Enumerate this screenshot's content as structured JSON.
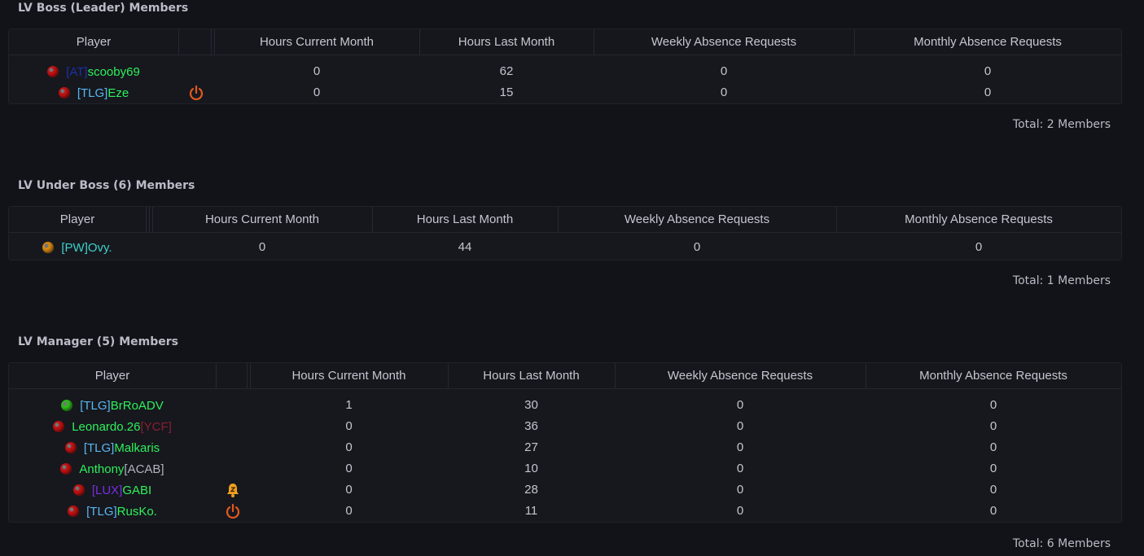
{
  "columns": {
    "player": "Player",
    "hours_current": "Hours Current Month",
    "hours_last": "Hours Last Month",
    "weekly_absence": "Weekly Absence Requests",
    "monthly_absence": "Monthly Absence Requests"
  },
  "status_colors": {
    "red": "#c41212",
    "green": "#2fbf1c",
    "orange": "#d88a12"
  },
  "sections": [
    {
      "title": "LV Boss (Leader) Members",
      "total": "Total: 2 Members",
      "rows": [
        {
          "status": "red",
          "tag": "[AT]",
          "tag_color": "#1f2fa8",
          "name": "scooby69",
          "name_color": "#2ef05a",
          "suffix": "",
          "suffix_color": "",
          "icon": "",
          "hours_current": "0",
          "hours_last": "62",
          "weekly": "0",
          "monthly": "0"
        },
        {
          "status": "red",
          "tag": "[TLG]",
          "tag_color": "#5ab6f0",
          "name": "Eze",
          "name_color": "#2ef05a",
          "suffix": "",
          "suffix_color": "",
          "icon": "power-icon",
          "hours_current": "0",
          "hours_last": "15",
          "weekly": "0",
          "monthly": "0"
        }
      ]
    },
    {
      "title": "LV Under Boss (6) Members",
      "total": "Total: 1 Members",
      "rows": [
        {
          "status": "orange",
          "tag": "[PW]",
          "tag_color": "#3fd0c8",
          "name": "Ovy.",
          "name_color": "#3fd0c8",
          "suffix": "",
          "suffix_color": "",
          "icon": "",
          "hours_current": "0",
          "hours_last": "44",
          "weekly": "0",
          "monthly": "0"
        }
      ]
    },
    {
      "title": "LV Manager (5) Members",
      "total": "Total: 6 Members",
      "rows": [
        {
          "status": "green",
          "tag": "[TLG]",
          "tag_color": "#5ab6f0",
          "name": "BrRoADV",
          "name_color": "#2ef05a",
          "suffix": "",
          "suffix_color": "",
          "icon": "",
          "hours_current": "1",
          "hours_last": "30",
          "weekly": "0",
          "monthly": "0"
        },
        {
          "status": "red",
          "tag": "",
          "tag_color": "",
          "name": "Leonardo.26",
          "name_color": "#2ef05a",
          "suffix": "[YCF]",
          "suffix_color": "#8b1e2e",
          "icon": "",
          "hours_current": "0",
          "hours_last": "36",
          "weekly": "0",
          "monthly": "0"
        },
        {
          "status": "red",
          "tag": "[TLG]",
          "tag_color": "#5ab6f0",
          "name": "Malkaris",
          "name_color": "#2ef05a",
          "suffix": "",
          "suffix_color": "",
          "icon": "",
          "hours_current": "0",
          "hours_last": "27",
          "weekly": "0",
          "monthly": "0"
        },
        {
          "status": "red",
          "tag": "",
          "tag_color": "",
          "name": "Anthony",
          "name_color": "#2ef05a",
          "suffix": "[ACAB]",
          "suffix_color": "#b0b3bb",
          "icon": "",
          "hours_current": "0",
          "hours_last": "10",
          "weekly": "0",
          "monthly": "0"
        },
        {
          "status": "red",
          "tag": "[LUX]",
          "tag_color": "#7a2de0",
          "name": "GABI",
          "name_color": "#2ef05a",
          "suffix": "",
          "suffix_color": "",
          "icon": "bell-icon",
          "hours_current": "0",
          "hours_last": "28",
          "weekly": "0",
          "monthly": "0"
        },
        {
          "status": "red",
          "tag": "[TLG]",
          "tag_color": "#5ab6f0",
          "name": "RusKo.",
          "name_color": "#2ef05a",
          "suffix": "",
          "suffix_color": "",
          "icon": "power-icon",
          "hours_current": "0",
          "hours_last": "11",
          "weekly": "0",
          "monthly": "0"
        }
      ]
    }
  ]
}
